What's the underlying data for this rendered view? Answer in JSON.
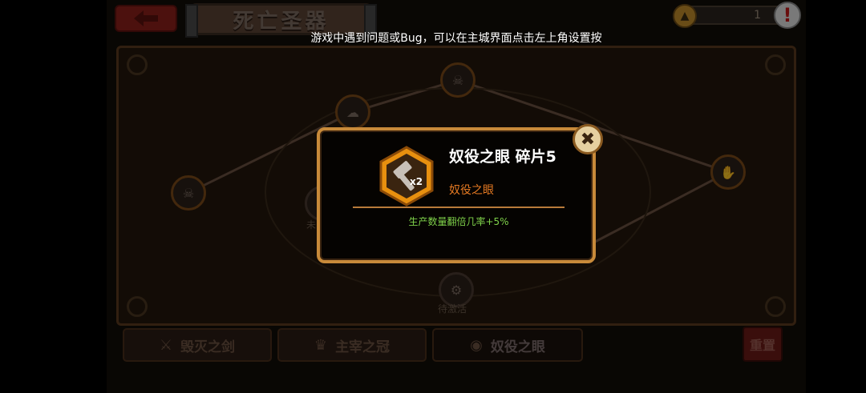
{
  "header": {
    "back_icon": "left-arrow-icon",
    "title": "死亡圣器",
    "counter_value": "1",
    "counter_icon": "helmet-icon",
    "alert_icon": "exclamation-icon"
  },
  "notice": "游戏中遇到问题或Bug，可以在主城界面点击左上角设置按",
  "map": {
    "nodes": [
      {
        "id": "left",
        "label": "",
        "icon": "skull-icon"
      },
      {
        "id": "upper-left",
        "label": "",
        "icon": "cloud-icon"
      },
      {
        "id": "top",
        "label": "",
        "icon": "skull-icon"
      },
      {
        "id": "right",
        "label": "",
        "icon": "hand-icon"
      },
      {
        "id": "mid-left",
        "label": "未",
        "icon": "locked-icon"
      },
      {
        "id": "bottom",
        "label": "待激活",
        "icon": "gear-icon"
      }
    ]
  },
  "tabs": [
    {
      "label": "毁灭之剑",
      "icon": "sword-icon",
      "active": false
    },
    {
      "label": "主宰之冠",
      "icon": "crown-icon",
      "active": false
    },
    {
      "label": "奴役之眼",
      "icon": "eye-icon",
      "active": true
    }
  ],
  "reset_label": "重置",
  "popup": {
    "title": "奴役之眼 碎片5",
    "set_name": "奴役之眼",
    "effect": "生产数量翻倍几率+5%",
    "badge_icon": "hammer-icon",
    "badge_text": "x2",
    "close_icon": "close-icon",
    "colors": {
      "border": "#c88a3a",
      "set_name": "#e67a22",
      "effect": "#7fd24a",
      "badge": "#e8900f"
    }
  }
}
